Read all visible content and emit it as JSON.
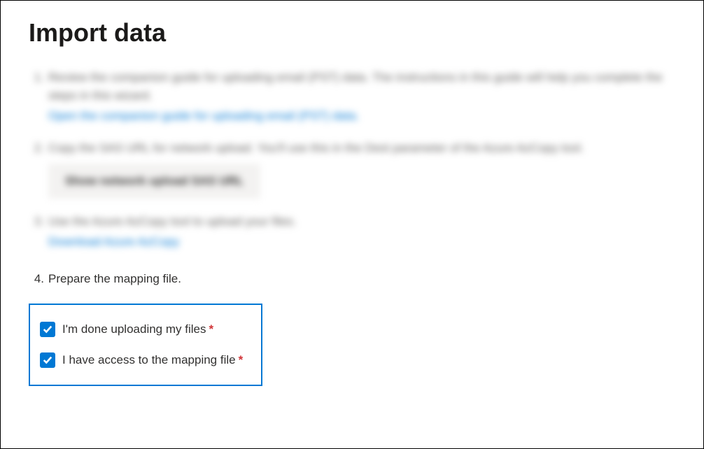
{
  "title": "Import data",
  "steps": {
    "s1": {
      "num": "1.",
      "text": "Review the companion guide for uploading email (PST) data. The instructions in this guide will help you complete the steps in this wizard.",
      "link": "Open the companion guide for uploading email (PST) data."
    },
    "s2": {
      "num": "2.",
      "text": "Copy the SAS URL for network upload. You'll use this in the Dest parameter of the Azure AzCopy tool.",
      "button": "Show network upload SAS URL"
    },
    "s3": {
      "num": "3.",
      "text": "Use the Azure AzCopy tool to upload your files.",
      "link": "Download Azure AzCopy"
    },
    "s4": {
      "num": "4.",
      "text": "Prepare the mapping file."
    }
  },
  "checkboxes": {
    "done_uploading": {
      "label": "I'm done uploading my files",
      "required": "*",
      "checked": true
    },
    "mapping_access": {
      "label": "I have access to the mapping file",
      "required": "*",
      "checked": true
    }
  }
}
